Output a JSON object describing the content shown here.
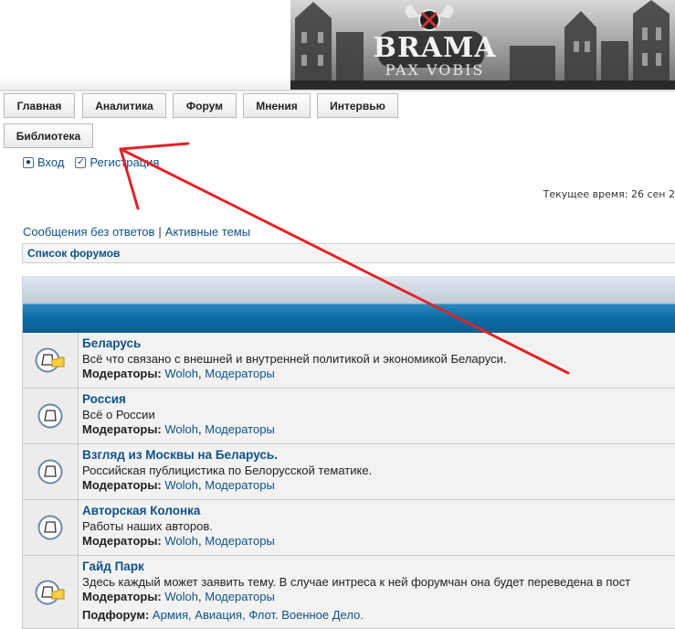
{
  "banner": {
    "logo_title": "BRAMA",
    "logo_subtitle": "PAX VOBIS"
  },
  "nav": {
    "items": [
      "Главная",
      "Аналитика",
      "Форум",
      "Мнения",
      "Интервью",
      "Библиотека"
    ]
  },
  "auth": {
    "login": "Вход",
    "register": "Регистрация"
  },
  "current_time": "Текущее время: 26 сен 2",
  "quick_links": {
    "unanswered": "Сообщения без ответов",
    "separator": "|",
    "active": "Активные темы"
  },
  "breadcrumb": "Список форумов",
  "labels": {
    "moderators": "Модераторы:",
    "subforum": "Подфорум:",
    "comma": ",",
    "comma2": ","
  },
  "forums": [
    {
      "title": "Беларусь",
      "description": "Всё что связано с внешней и внутренней политикой и экономикой Беларуси.",
      "moderators": [
        "Woloh",
        "Модераторы"
      ]
    },
    {
      "title": "Россия",
      "description": "Всё о России",
      "moderators": [
        "Woloh",
        "Модераторы"
      ]
    },
    {
      "title": "Взгляд из Москвы на Беларусь.",
      "description": "Российская публицистика по Белорусской тематике.",
      "moderators": [
        "Woloh",
        "Модераторы"
      ]
    },
    {
      "title": "Авторская Колонка",
      "description": "Работы наших авторов.",
      "moderators": [
        "Woloh",
        "Модераторы"
      ]
    },
    {
      "title": "Гайд Парк",
      "description": "Здесь каждый может заявить тему. В случае интреса к ней форумчан она будет переведена в пост",
      "moderators": [
        "Woloh",
        "Модераторы"
      ],
      "subforums": [
        "Армия, Авиация, Флот. Военное Дело."
      ]
    }
  ],
  "colors": {
    "link": "#105289",
    "header_blue": "#0a6aa3",
    "arrow": "#e0242a"
  }
}
